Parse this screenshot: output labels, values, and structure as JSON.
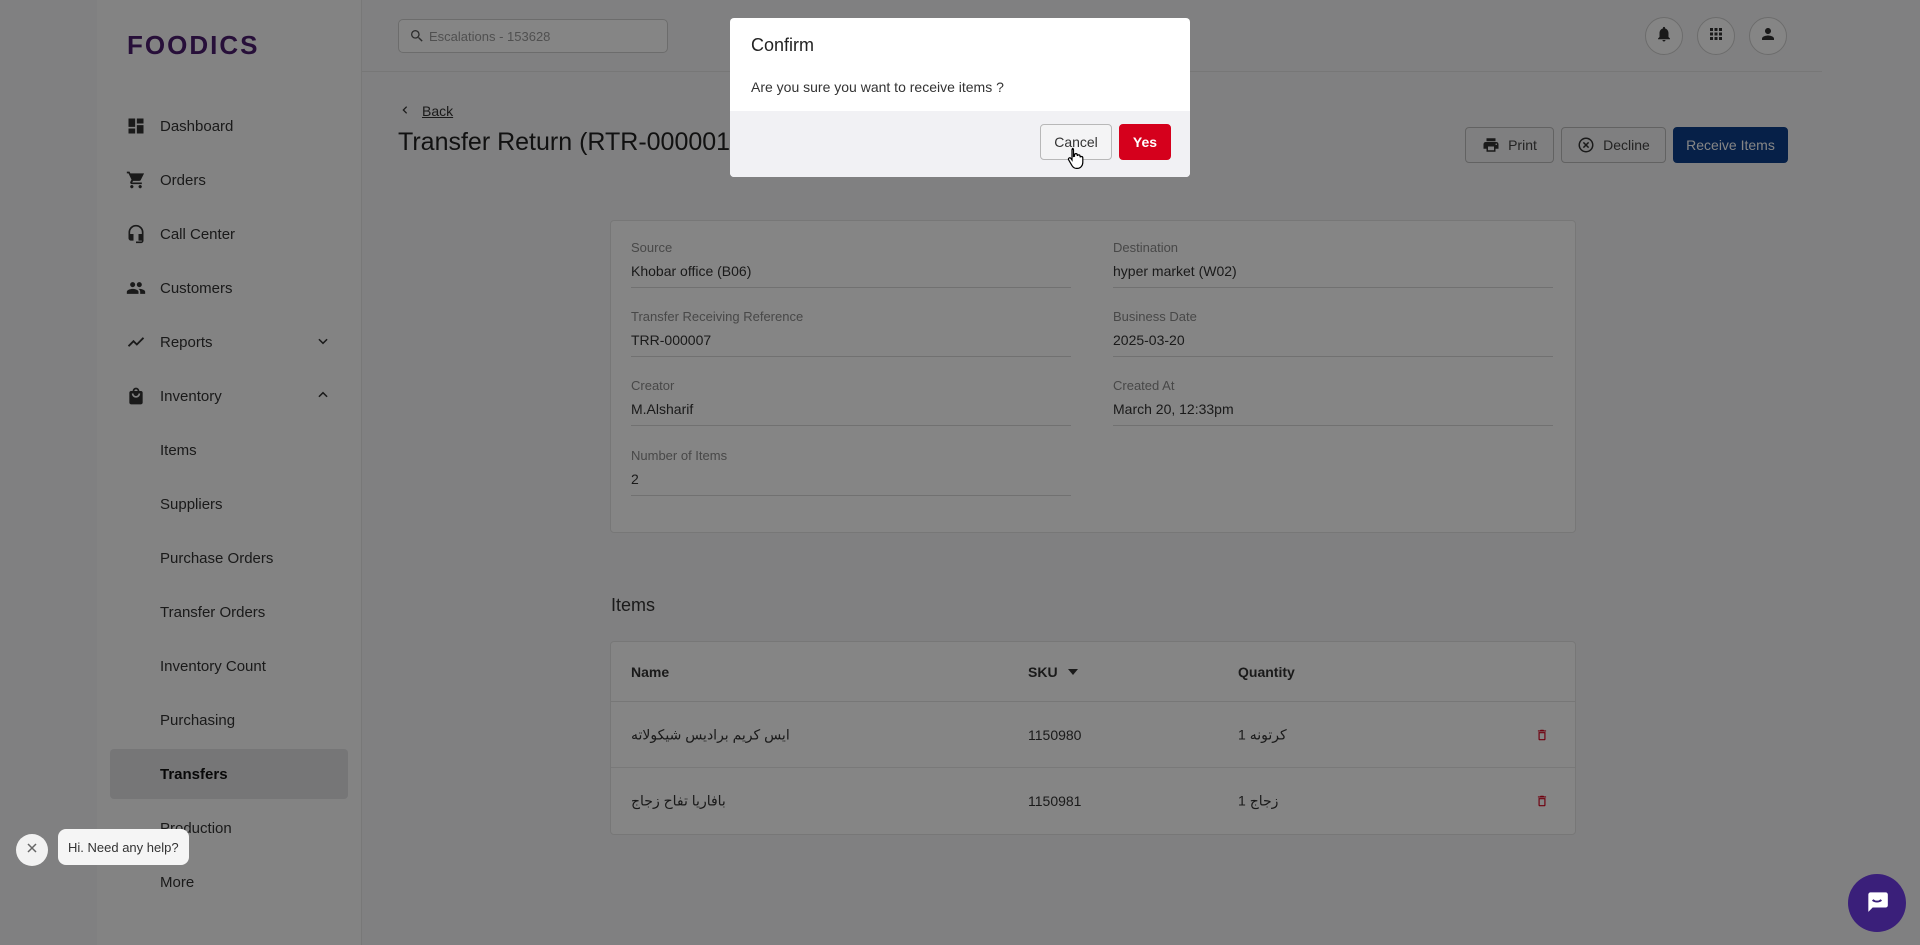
{
  "app": {
    "logo": "FOODICS"
  },
  "search": {
    "placeholder": "Escalations - 153628"
  },
  "sidebar": {
    "items": [
      {
        "label": "Dashboard",
        "icon": "dashboard-icon"
      },
      {
        "label": "Orders",
        "icon": "cart-icon"
      },
      {
        "label": "Call Center",
        "icon": "headset-icon"
      },
      {
        "label": "Customers",
        "icon": "people-icon"
      },
      {
        "label": "Reports",
        "icon": "trending-icon"
      },
      {
        "label": "Inventory",
        "icon": "bag-icon"
      },
      {
        "label": "Items"
      },
      {
        "label": "Suppliers"
      },
      {
        "label": "Purchase Orders"
      },
      {
        "label": "Transfer Orders"
      },
      {
        "label": "Inventory Count"
      },
      {
        "label": "Purchasing"
      },
      {
        "label": "Transfers"
      },
      {
        "label": "Production"
      },
      {
        "label": "More"
      }
    ]
  },
  "page": {
    "back_label": "Back",
    "title": "Transfer Return (RTR-000001",
    "actions": {
      "print": "Print",
      "decline": "Decline",
      "receive": "Receive Items"
    }
  },
  "details": {
    "source": {
      "label": "Source",
      "value": "Khobar office (B06)"
    },
    "destination": {
      "label": "Destination",
      "value": "hyper market (W02)"
    },
    "reference": {
      "label": "Transfer Receiving Reference",
      "value": "TRR-000007"
    },
    "business_date": {
      "label": "Business Date",
      "value": "2025-03-20"
    },
    "creator": {
      "label": "Creator",
      "value": "M.Alsharif"
    },
    "created_at": {
      "label": "Created At",
      "value": "March 20, 12:33pm"
    },
    "num_items": {
      "label": "Number of Items",
      "value": "2"
    }
  },
  "items": {
    "title": "Items",
    "columns": {
      "name": "Name",
      "sku": "SKU",
      "quantity": "Quantity"
    },
    "rows": [
      {
        "name": "ايس كريم براديس شيكولاته",
        "sku": "1150980",
        "quantity": "1 كرتونه"
      },
      {
        "name": "بافاريا تفاح زجاج",
        "sku": "1150981",
        "quantity": "1 زجاج"
      }
    ]
  },
  "modal": {
    "title": "Confirm",
    "message": "Are you sure you want to receive items ?",
    "cancel": "Cancel",
    "yes": "Yes"
  },
  "help": {
    "text": "Hi. Need any help?"
  },
  "colors": {
    "primary": "#0c3f8a",
    "danger": "#d5001c",
    "brand": "#4b1e6e",
    "chat": "#3a1f7a"
  }
}
